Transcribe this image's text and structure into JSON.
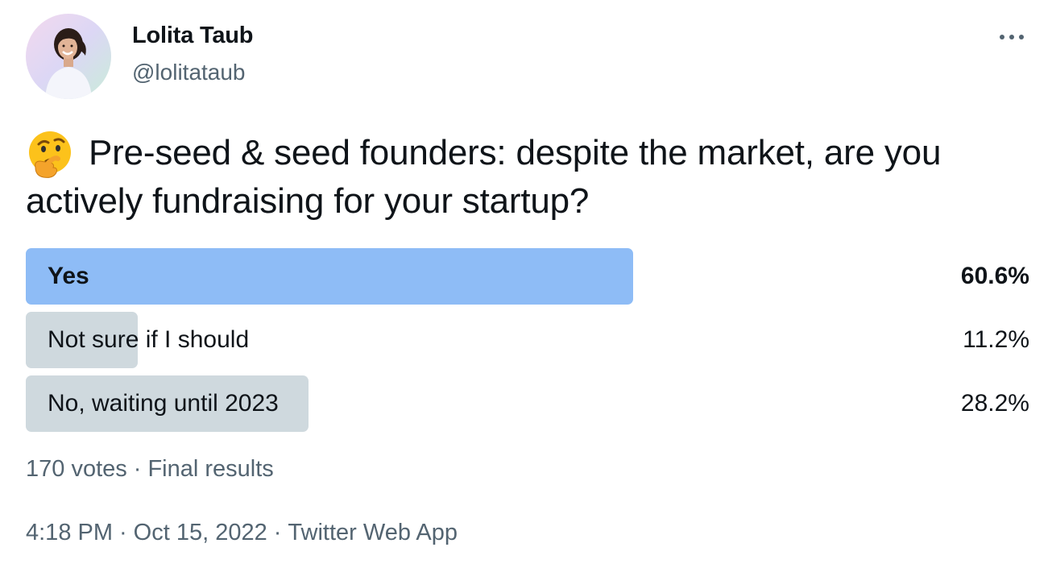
{
  "author": {
    "display_name": "Lolita Taub",
    "handle": "@lolitataub",
    "avatar_icon": "profile-photo"
  },
  "menu": {
    "icon": "more-horizontal-icon"
  },
  "tweet": {
    "emoji": "thinking-face-emoji",
    "text": "Pre-seed & seed founders: despite the market, are you actively fundraising for your startup?"
  },
  "poll": {
    "options": [
      {
        "label": "Yes",
        "percent_text": "60.6%",
        "percent": 60.6,
        "winner": true
      },
      {
        "label": "Not sure if I should",
        "percent_text": "11.2%",
        "percent": 11.2,
        "winner": false
      },
      {
        "label": "No, waiting until 2023",
        "percent_text": "28.2%",
        "percent": 28.2,
        "winner": false
      }
    ],
    "votes": "170 votes",
    "separator": "·",
    "status": "Final results"
  },
  "meta": {
    "time": "4:18 PM",
    "date": "Oct 15, 2022",
    "source": "Twitter Web App",
    "separator": "·"
  },
  "colors": {
    "winner_bar": "#8ebcf6",
    "other_bar": "#cfd9de",
    "secondary_text": "#536471",
    "primary_text": "#0f1419"
  }
}
